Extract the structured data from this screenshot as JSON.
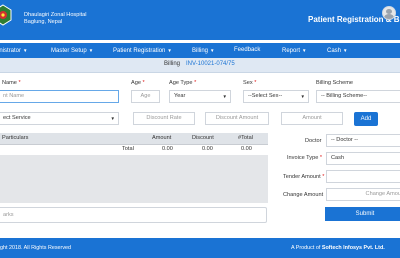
{
  "header": {
    "hospital_name": "Dhaulagiri Zonal Hospital",
    "hospital_location": "Baglung, Nepal",
    "page_title": "Patient Registration & Bill"
  },
  "nav": {
    "items": [
      "inistrator",
      "Master Setup",
      "Patient Registration",
      "Billing",
      "Feedback",
      "Report",
      "Cash"
    ]
  },
  "billing": {
    "label": "Billing",
    "number": "INV-10021-074/75"
  },
  "form": {
    "name_label": "Name",
    "name_placeholder": "nt Name",
    "age_label": "Age",
    "age_placeholder": "Age",
    "age_type_label": "Age Type",
    "age_type_value": "Year",
    "sex_label": "Sex",
    "sex_value": "--Select Sex--",
    "billing_scheme_label": "Billing Scheme",
    "billing_scheme_value": "-- Billing Scheme--",
    "service_value": "ect Service",
    "discount_rate_placeholder": "Discount Rate",
    "discount_amount_placeholder": "Discount Amount",
    "amount_placeholder": "Amount",
    "add_label": "Add",
    "doctor_label": "Doctor",
    "doctor_value": "-- Doctor --",
    "invoice_type_label": "Invoice Type",
    "invoice_type_value": "Cash",
    "tender_amount_label": "Tender Amount",
    "change_amount_label": "Change Amount",
    "change_amount_placeholder": "Change Amou",
    "remarks_placeholder": "arks",
    "submit_label": "Submit"
  },
  "table": {
    "headers": {
      "particulars": "Particulars",
      "amount": "Amount",
      "discount": "Discount",
      "total": "#Total"
    },
    "total_row": {
      "label": "Total",
      "amount": "0.00",
      "discount": "0.00",
      "total": "0.00"
    }
  },
  "footer": {
    "copyright": "ght 2018. All Rights Reserved",
    "product_prefix": "A Product of",
    "company": "Softech Infosys Pvt. Ltd."
  },
  "colors": {
    "primary": "#1a73d4",
    "required": "#e02020"
  }
}
